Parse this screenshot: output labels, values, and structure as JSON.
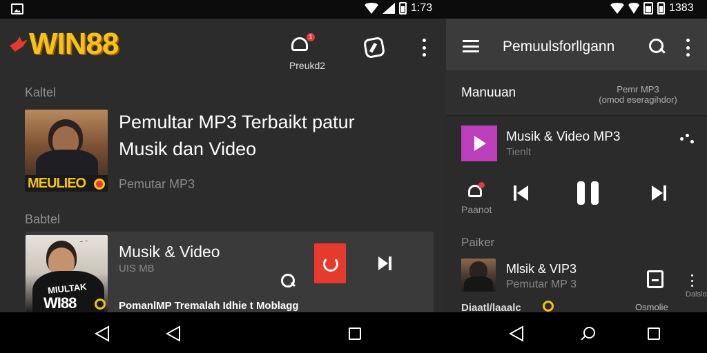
{
  "status_bar": {
    "left_time": "1:73",
    "right_time": "1383",
    "icons": [
      "gallery-icon",
      "wifi-icon",
      "signal-icon",
      "battery-icon"
    ]
  },
  "left_panel": {
    "logo_text": "WIN88",
    "notification": {
      "badge": "1",
      "label": "Preukd2"
    },
    "section1_label": "Kaltel",
    "featured": {
      "title_line1": "Pemultar MP3 Terbaikt patur",
      "title_line2": "Musik dan Video",
      "subtitle": "Pemutar MP3",
      "thumb_caption": "MEULIEO"
    },
    "section2_label": "Babtel",
    "row": {
      "title": "Musik & Video",
      "size": "UIS MB",
      "footer": "PomanlMP Tremalah Idhie t Moblagg",
      "thumb_caption": "WI88",
      "thumb_overlay": "MIULTAK"
    }
  },
  "right_panel": {
    "title": "Pemuulsforllgann",
    "section_title": "Manuuan",
    "section_meta_line1": "Pemr MP3",
    "section_meta_line2": "(omod eseragihdor)",
    "now_playing": {
      "title": "Musik & Video MP3",
      "subtitle": "Tienlt"
    },
    "mini_bell": {
      "badge": "1",
      "label": "Paanot"
    },
    "list_label": "Paiker",
    "list_item": {
      "title": "Mlsik & VIP3",
      "subtitle": "Pemutar MP 3",
      "side_label": "Dalslo"
    },
    "footer_left": "Diaatl/laaalc",
    "footer_right": "Osmolie"
  },
  "colors": {
    "logo_gold": "#f5c21a",
    "accent_red": "#e53a2c",
    "play_tile": "#bb3fbb",
    "panel_bg": "#2c2c2c",
    "header_bg": "#3b3b3b"
  }
}
